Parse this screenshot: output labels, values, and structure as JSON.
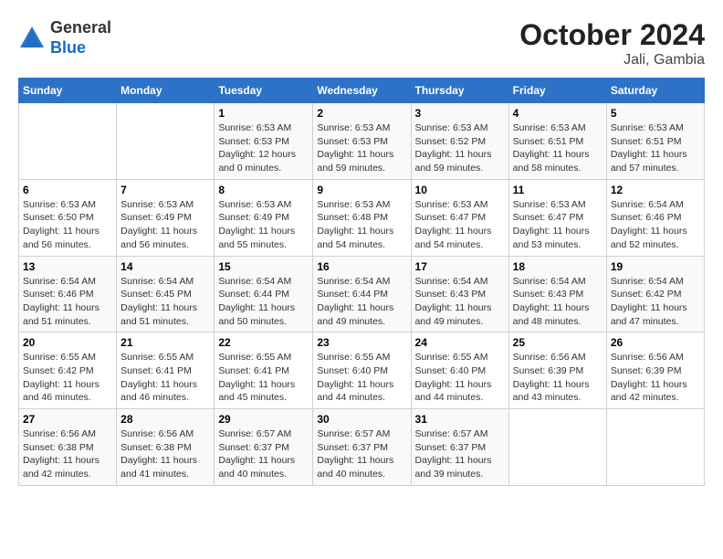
{
  "logo": {
    "general": "General",
    "blue": "Blue"
  },
  "title": "October 2024",
  "subtitle": "Jali, Gambia",
  "days_of_week": [
    "Sunday",
    "Monday",
    "Tuesday",
    "Wednesday",
    "Thursday",
    "Friday",
    "Saturday"
  ],
  "weeks": [
    [
      {
        "day": "",
        "details": ""
      },
      {
        "day": "",
        "details": ""
      },
      {
        "day": "1",
        "details": "Sunrise: 6:53 AM\nSunset: 6:53 PM\nDaylight: 12 hours\nand 0 minutes."
      },
      {
        "day": "2",
        "details": "Sunrise: 6:53 AM\nSunset: 6:53 PM\nDaylight: 11 hours\nand 59 minutes."
      },
      {
        "day": "3",
        "details": "Sunrise: 6:53 AM\nSunset: 6:52 PM\nDaylight: 11 hours\nand 59 minutes."
      },
      {
        "day": "4",
        "details": "Sunrise: 6:53 AM\nSunset: 6:51 PM\nDaylight: 11 hours\nand 58 minutes."
      },
      {
        "day": "5",
        "details": "Sunrise: 6:53 AM\nSunset: 6:51 PM\nDaylight: 11 hours\nand 57 minutes."
      }
    ],
    [
      {
        "day": "6",
        "details": "Sunrise: 6:53 AM\nSunset: 6:50 PM\nDaylight: 11 hours\nand 56 minutes."
      },
      {
        "day": "7",
        "details": "Sunrise: 6:53 AM\nSunset: 6:49 PM\nDaylight: 11 hours\nand 56 minutes."
      },
      {
        "day": "8",
        "details": "Sunrise: 6:53 AM\nSunset: 6:49 PM\nDaylight: 11 hours\nand 55 minutes."
      },
      {
        "day": "9",
        "details": "Sunrise: 6:53 AM\nSunset: 6:48 PM\nDaylight: 11 hours\nand 54 minutes."
      },
      {
        "day": "10",
        "details": "Sunrise: 6:53 AM\nSunset: 6:47 PM\nDaylight: 11 hours\nand 54 minutes."
      },
      {
        "day": "11",
        "details": "Sunrise: 6:53 AM\nSunset: 6:47 PM\nDaylight: 11 hours\nand 53 minutes."
      },
      {
        "day": "12",
        "details": "Sunrise: 6:54 AM\nSunset: 6:46 PM\nDaylight: 11 hours\nand 52 minutes."
      }
    ],
    [
      {
        "day": "13",
        "details": "Sunrise: 6:54 AM\nSunset: 6:46 PM\nDaylight: 11 hours\nand 51 minutes."
      },
      {
        "day": "14",
        "details": "Sunrise: 6:54 AM\nSunset: 6:45 PM\nDaylight: 11 hours\nand 51 minutes."
      },
      {
        "day": "15",
        "details": "Sunrise: 6:54 AM\nSunset: 6:44 PM\nDaylight: 11 hours\nand 50 minutes."
      },
      {
        "day": "16",
        "details": "Sunrise: 6:54 AM\nSunset: 6:44 PM\nDaylight: 11 hours\nand 49 minutes."
      },
      {
        "day": "17",
        "details": "Sunrise: 6:54 AM\nSunset: 6:43 PM\nDaylight: 11 hours\nand 49 minutes."
      },
      {
        "day": "18",
        "details": "Sunrise: 6:54 AM\nSunset: 6:43 PM\nDaylight: 11 hours\nand 48 minutes."
      },
      {
        "day": "19",
        "details": "Sunrise: 6:54 AM\nSunset: 6:42 PM\nDaylight: 11 hours\nand 47 minutes."
      }
    ],
    [
      {
        "day": "20",
        "details": "Sunrise: 6:55 AM\nSunset: 6:42 PM\nDaylight: 11 hours\nand 46 minutes."
      },
      {
        "day": "21",
        "details": "Sunrise: 6:55 AM\nSunset: 6:41 PM\nDaylight: 11 hours\nand 46 minutes."
      },
      {
        "day": "22",
        "details": "Sunrise: 6:55 AM\nSunset: 6:41 PM\nDaylight: 11 hours\nand 45 minutes."
      },
      {
        "day": "23",
        "details": "Sunrise: 6:55 AM\nSunset: 6:40 PM\nDaylight: 11 hours\nand 44 minutes."
      },
      {
        "day": "24",
        "details": "Sunrise: 6:55 AM\nSunset: 6:40 PM\nDaylight: 11 hours\nand 44 minutes."
      },
      {
        "day": "25",
        "details": "Sunrise: 6:56 AM\nSunset: 6:39 PM\nDaylight: 11 hours\nand 43 minutes."
      },
      {
        "day": "26",
        "details": "Sunrise: 6:56 AM\nSunset: 6:39 PM\nDaylight: 11 hours\nand 42 minutes."
      }
    ],
    [
      {
        "day": "27",
        "details": "Sunrise: 6:56 AM\nSunset: 6:38 PM\nDaylight: 11 hours\nand 42 minutes."
      },
      {
        "day": "28",
        "details": "Sunrise: 6:56 AM\nSunset: 6:38 PM\nDaylight: 11 hours\nand 41 minutes."
      },
      {
        "day": "29",
        "details": "Sunrise: 6:57 AM\nSunset: 6:37 PM\nDaylight: 11 hours\nand 40 minutes."
      },
      {
        "day": "30",
        "details": "Sunrise: 6:57 AM\nSunset: 6:37 PM\nDaylight: 11 hours\nand 40 minutes."
      },
      {
        "day": "31",
        "details": "Sunrise: 6:57 AM\nSunset: 6:37 PM\nDaylight: 11 hours\nand 39 minutes."
      },
      {
        "day": "",
        "details": ""
      },
      {
        "day": "",
        "details": ""
      }
    ]
  ]
}
